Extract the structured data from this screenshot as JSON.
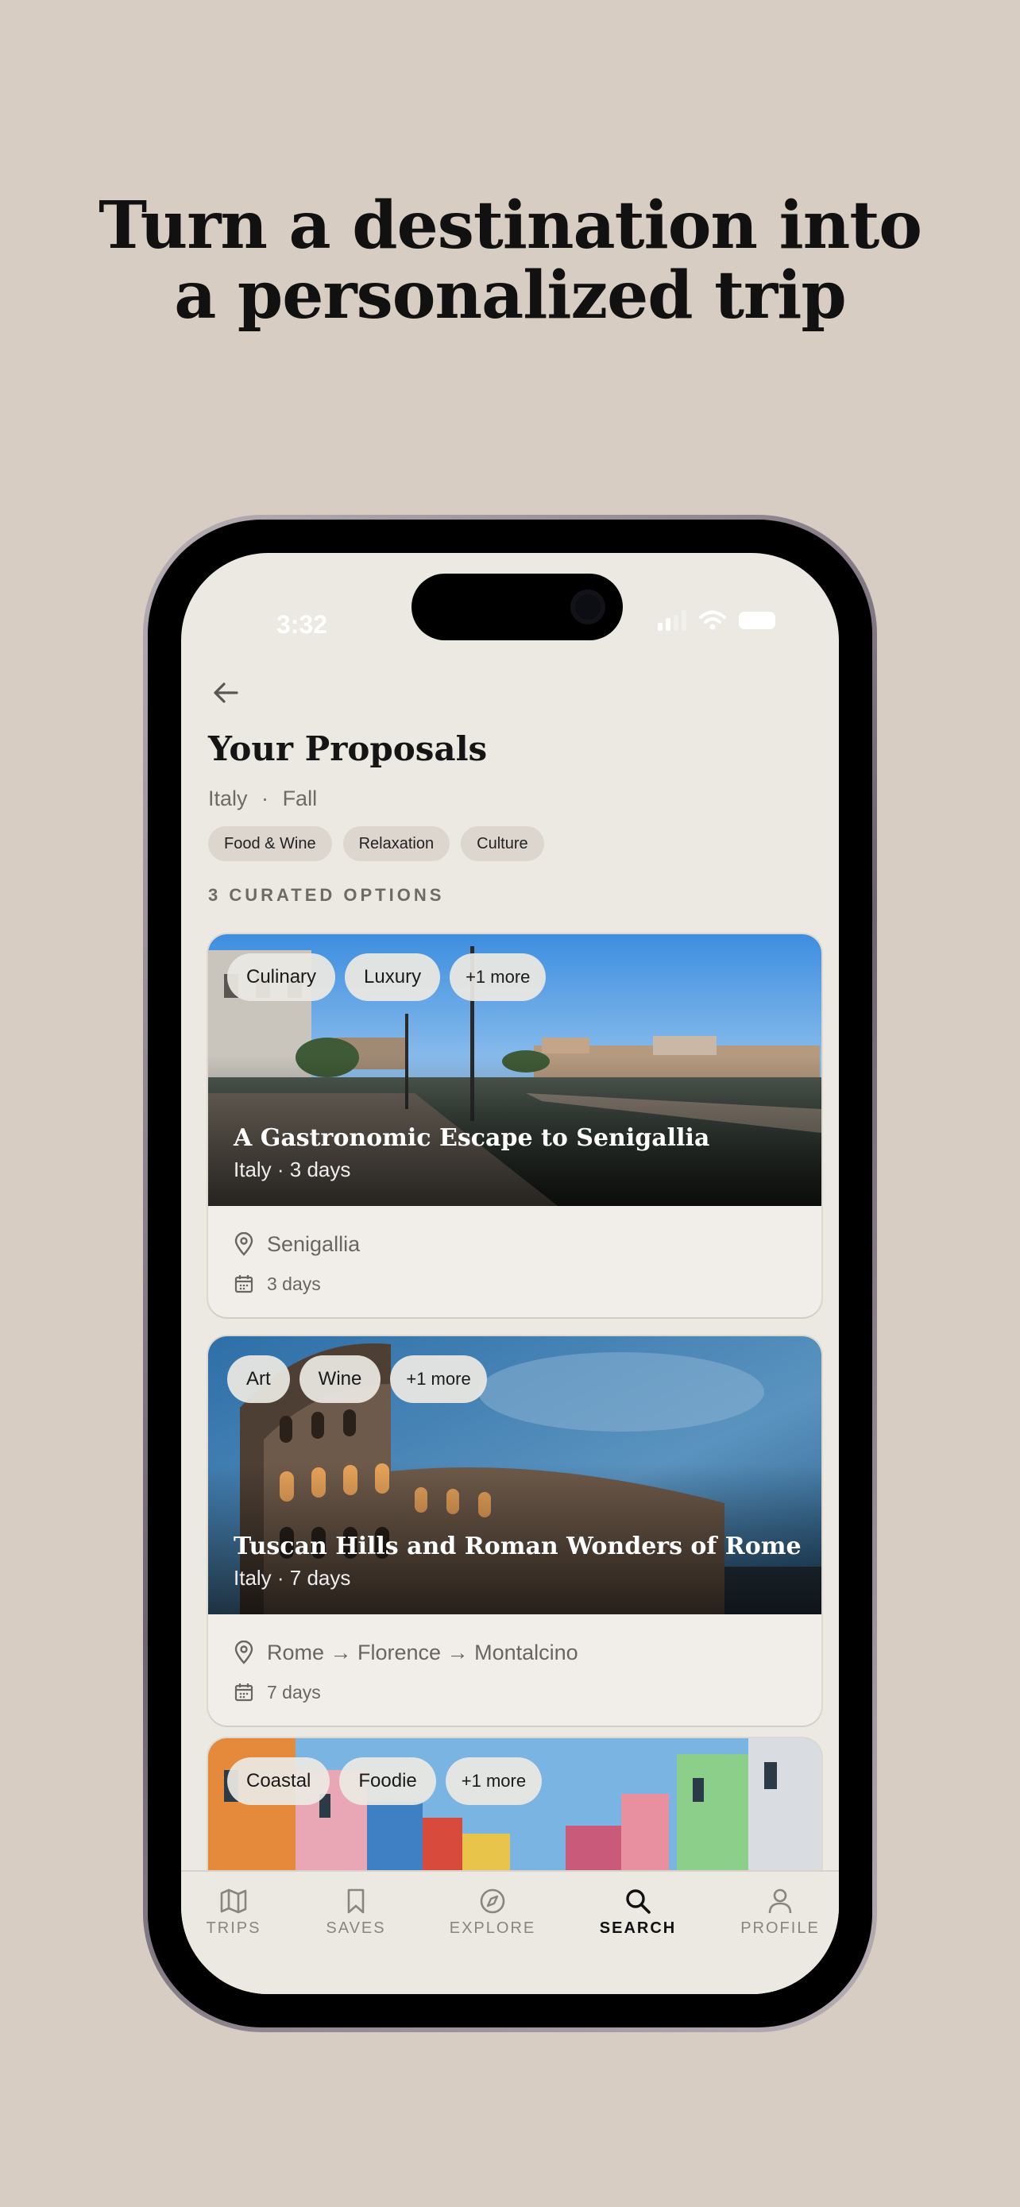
{
  "headline": {
    "line1": "Turn a destination into",
    "line2": "a personalized trip"
  },
  "status": {
    "time": "3:32"
  },
  "page": {
    "title": "Your Proposals",
    "country": "Italy",
    "separator": "·",
    "season": "Fall",
    "interests": [
      "Food & Wine",
      "Relaxation",
      "Culture"
    ],
    "section_label": "3 CURATED OPTIONS"
  },
  "cards": [
    {
      "tags": [
        "Culinary",
        "Luxury",
        "+1 more"
      ],
      "title": "A Gastronomic Escape to Senigallia",
      "subtitle": "Italy · 3 days",
      "location": "Senigallia",
      "duration": "3 days"
    },
    {
      "tags": [
        "Art",
        "Wine",
        "+1 more"
      ],
      "title": "Tuscan Hills and Roman Wonders of Rome",
      "subtitle": "Italy · 7 days",
      "location": "Rome → Florence → Montalcino",
      "duration": "7 days"
    },
    {
      "tags": [
        "Coastal",
        "Foodie",
        "+1 more"
      ]
    }
  ],
  "tabbar": {
    "items": [
      {
        "label": "TRIPS",
        "icon": "map-icon"
      },
      {
        "label": "SAVES",
        "icon": "bookmark-icon"
      },
      {
        "label": "EXPLORE",
        "icon": "compass-icon"
      },
      {
        "label": "SEARCH",
        "icon": "search-icon"
      },
      {
        "label": "PROFILE",
        "icon": "person-icon"
      }
    ],
    "active": "SEARCH"
  },
  "colors": {
    "background": "#d8cdc2",
    "screen": "#ece8e2",
    "chip": "#dcd6ce",
    "text_primary": "#151515",
    "text_muted": "#6e6a66"
  }
}
